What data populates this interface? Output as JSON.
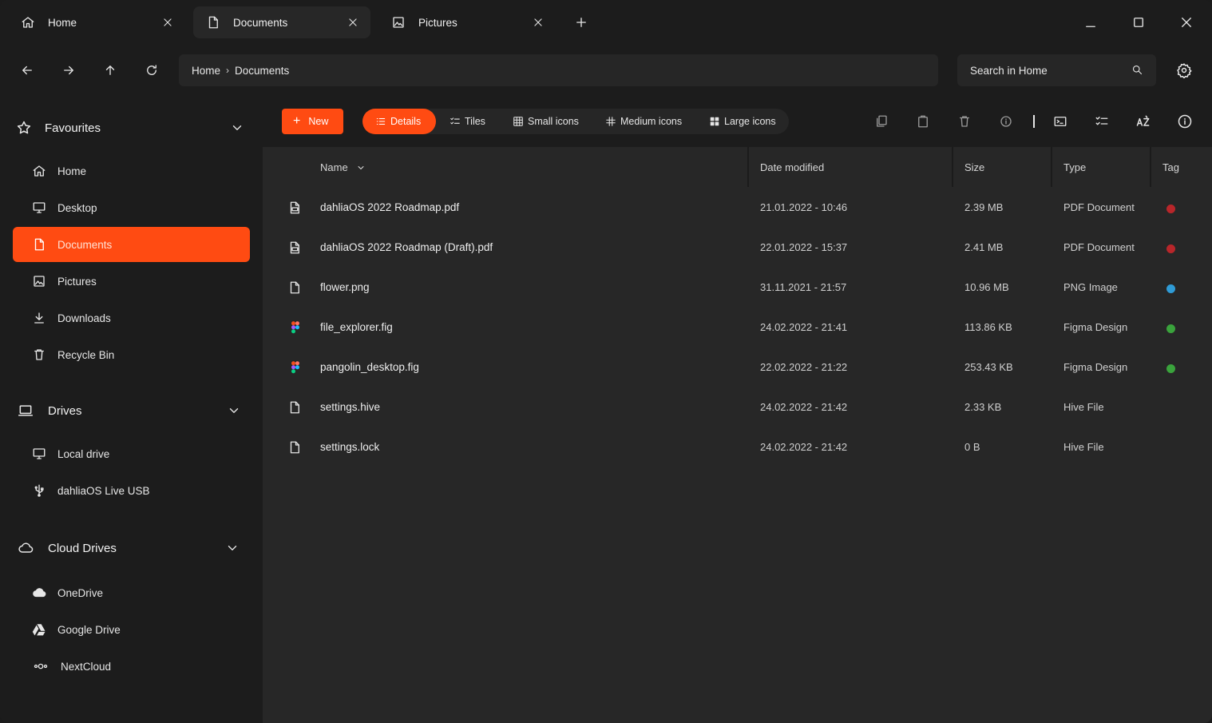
{
  "tabs": [
    {
      "label": "Home",
      "icon": "home-icon"
    },
    {
      "label": "Documents",
      "icon": "document-icon"
    },
    {
      "label": "Pictures",
      "icon": "image-icon"
    }
  ],
  "breadcrumb": {
    "items": [
      "Home",
      "Documents"
    ]
  },
  "search": {
    "placeholder": "Search in Home"
  },
  "sidebar": {
    "favourites": {
      "title": "Favourites",
      "items": [
        {
          "label": "Home",
          "icon": "home-icon"
        },
        {
          "label": "Desktop",
          "icon": "monitor-icon"
        },
        {
          "label": "Documents",
          "icon": "document-icon"
        },
        {
          "label": "Pictures",
          "icon": "image-icon"
        },
        {
          "label": "Downloads",
          "icon": "download-icon"
        },
        {
          "label": "Recycle Bin",
          "icon": "trash-icon"
        }
      ]
    },
    "drives": {
      "title": "Drives",
      "items": [
        {
          "label": "Local drive",
          "icon": "monitor-icon"
        },
        {
          "label": "dahliaOS Live USB",
          "icon": "usb-icon"
        }
      ]
    },
    "cloud": {
      "title": "Cloud Drives",
      "items": [
        {
          "label": "OneDrive",
          "icon": "cloud-icon"
        },
        {
          "label": "Google Drive",
          "icon": "google-drive-icon"
        },
        {
          "label": "NextCloud",
          "icon": "nextcloud-icon"
        }
      ]
    }
  },
  "toolbar": {
    "new_label": "New",
    "views": [
      "Details",
      "Tiles",
      "Small icons",
      "Medium icons",
      "Large icons"
    ]
  },
  "table": {
    "headers": {
      "name": "Name",
      "date": "Date modified",
      "size": "Size",
      "type": "Type",
      "tag": "Tag"
    },
    "rows": [
      {
        "name": "dahliaOS 2022 Roadmap.pdf",
        "date": "21.01.2022 -  10:46",
        "size": "2.39 MB",
        "type": "PDF Document",
        "tag": "#b8262a",
        "icon": "pdf-icon"
      },
      {
        "name": "dahliaOS 2022 Roadmap (Draft).pdf",
        "date": "22.01.2022 -  15:37",
        "size": "2.41 MB",
        "type": "PDF Document",
        "tag": "#b8262a",
        "icon": "pdf-icon"
      },
      {
        "name": "flower.png",
        "date": "31.11.2021 -  21:57",
        "size": "10.96 MB",
        "type": "PNG Image",
        "tag": "#2f9bd6",
        "icon": "file-icon"
      },
      {
        "name": "file_explorer.fig",
        "date": "24.02.2022 -  21:41",
        "size": "113.86 KB",
        "type": "Figma Design",
        "tag": "#3aa33c",
        "icon": "figma-icon"
      },
      {
        "name": "pangolin_desktop.fig",
        "date": "22.02.2022 -  21:22",
        "size": "253.43 KB",
        "type": "Figma Design",
        "tag": "#3aa33c",
        "icon": "figma-icon"
      },
      {
        "name": "settings.hive",
        "date": "24.02.2022 -  21:42",
        "size": "2.33 KB",
        "type": "Hive File",
        "tag": "",
        "icon": "file-icon"
      },
      {
        "name": "settings.lock",
        "date": "24.02.2022 -  21:42",
        "size": "0 B",
        "type": "Hive File",
        "tag": "",
        "icon": "file-icon"
      }
    ]
  },
  "colors": {
    "accent": "#ff4b12",
    "background": "#1c1c1c",
    "content": "#272727"
  }
}
